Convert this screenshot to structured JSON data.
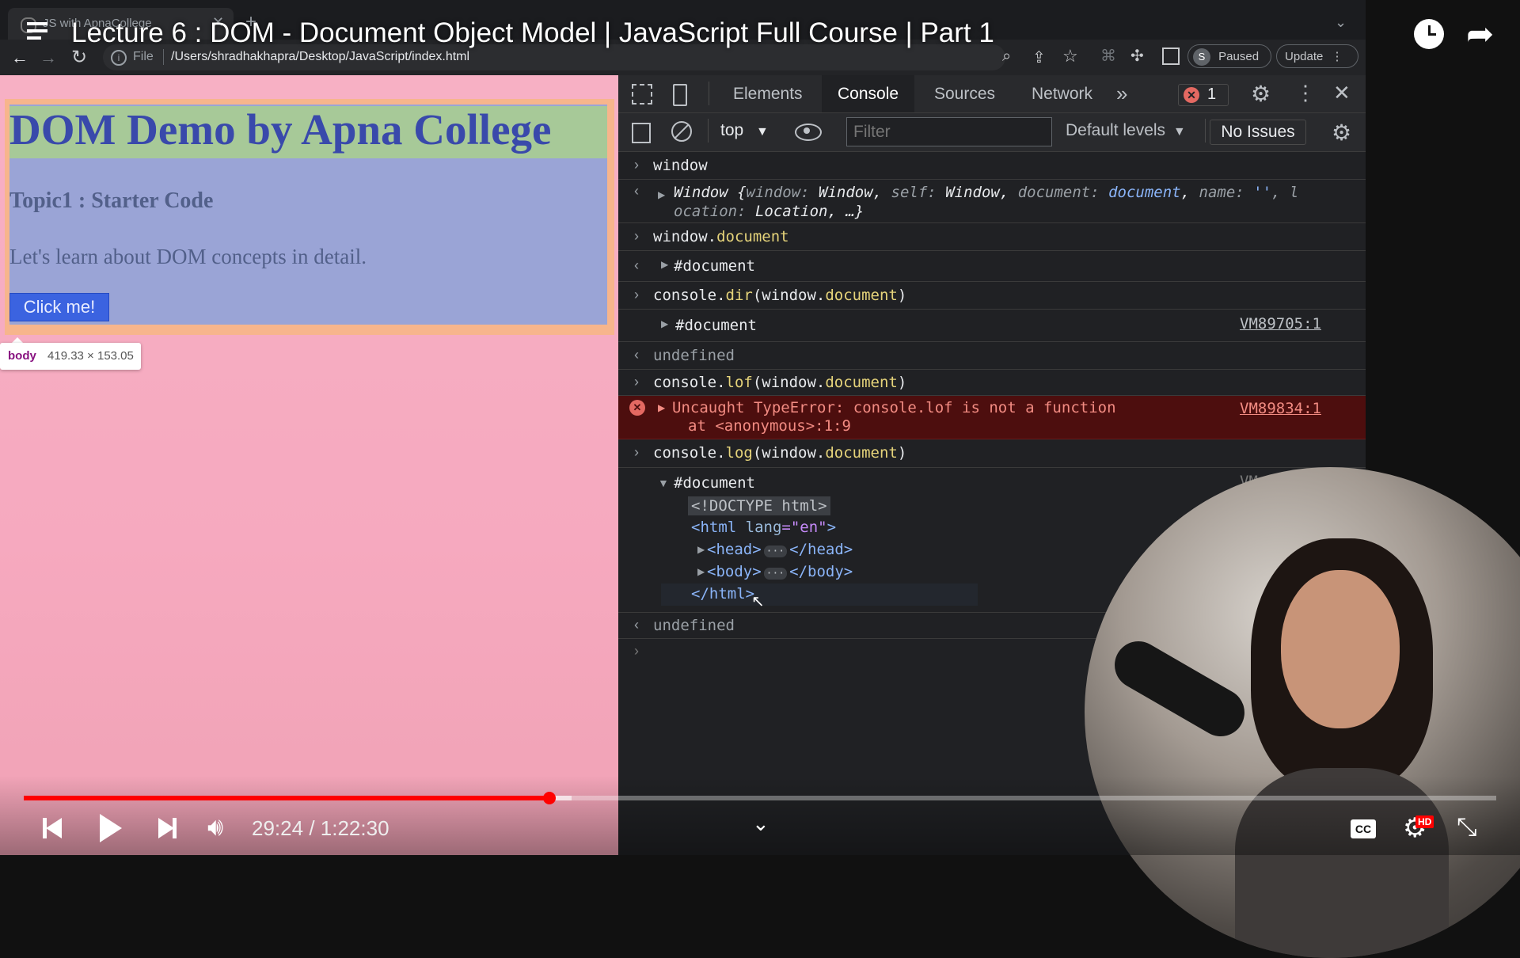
{
  "video": {
    "title": "Lecture 6 : DOM - Document Object Model | JavaScript Full Course | Part 1",
    "current_time": "29:24",
    "separator": "/",
    "duration": "1:22:30",
    "progress_fraction": 0.357,
    "cc_label": "CC",
    "hd_badge": "HD"
  },
  "browser": {
    "tab_title": "JS with ApnaCollege",
    "url_prefix": "File",
    "url_path": "/Users/shradhakhapra/Desktop/JavaScript/index.html",
    "profile_initial": "S",
    "paused_label": "Paused",
    "update_label": "Update"
  },
  "page": {
    "heading": "DOM Demo by Apna College",
    "topic": "Topic1 : Starter Code",
    "paragraph": "Let's learn about DOM concepts in detail.",
    "button_label": "Click me!",
    "tooltip_tag": "body",
    "tooltip_size": "419.33 × 153.05"
  },
  "devtools": {
    "tabs": [
      "Elements",
      "Console",
      "Sources",
      "Network"
    ],
    "active_tab": "Console",
    "more_tabs": "»",
    "error_count": "1",
    "context": "top",
    "filter_placeholder": "Filter",
    "levels": "Default levels",
    "issues": "No Issues",
    "console": {
      "r1_in": "window",
      "r2_a": "Window {",
      "r2_b": "window: ",
      "r2_c": "Window, ",
      "r2_d": "self: ",
      "r2_e": "Window, ",
      "r2_f": "document: ",
      "r2_g": "document",
      "r2_h": ", ",
      "r2_i": "name: ",
      "r2_j": "''",
      "r2_k": ", l",
      "r2_l": "ocation: ",
      "r2_m": "Location, …}",
      "r3_a": "window.",
      "r3_b": "document",
      "r4": "#document",
      "r5_a": "console.",
      "r5_b": "dir",
      "r5_c": "(window.",
      "r5_d": "document",
      "r5_e": ")",
      "r6": "#document",
      "r6_src": "VM89705:1",
      "r7": "undefined",
      "r8_a": "console.",
      "r8_b": "lof",
      "r8_c": "(window.",
      "r8_d": "document",
      "r8_e": ")",
      "err_1": "Uncaught TypeError: console.lof is not a function",
      "err_2": "at <anonymous>:1:9",
      "err_src": "VM89834:1",
      "r10_a": "console.",
      "r10_b": "log",
      "r10_c": "(window.",
      "r10_d": "document",
      "r10_e": ")",
      "r11": "#document",
      "r11_src": "VM",
      "tree_doctype": "<!DOCTYPE html>",
      "tree_html_a": "<html ",
      "tree_html_b": "lang",
      "tree_html_c": "=\"en\"",
      "tree_html_d": ">",
      "tree_head_open": "<head>",
      "tree_head_close": "</head>",
      "tree_body_open": "<body>",
      "tree_body_close": "</body>",
      "tree_ellipsis": "···",
      "tree_html_close": "</html>",
      "r12": "undefined"
    }
  },
  "colors": {
    "progress": "#ff0000",
    "page_bg": "#f7b0c4",
    "heading": "#3949ab",
    "error_bg": "#4d0e0e",
    "error_text": "#f28b82"
  }
}
